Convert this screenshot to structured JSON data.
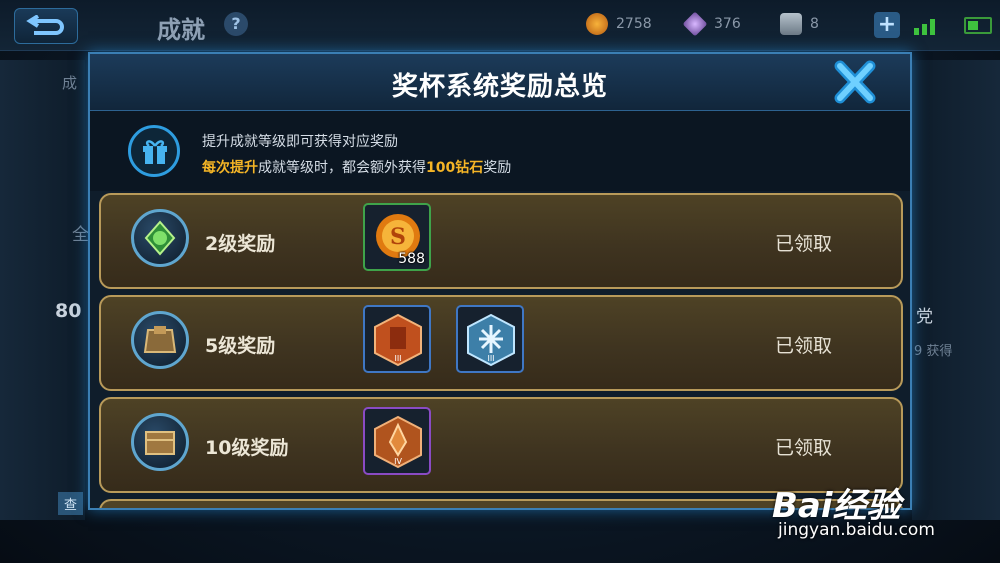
{
  "background": {
    "screen_title": "成就",
    "help_symbol": "?",
    "currencies": [
      {
        "icon": "gold-coin-icon",
        "value": "2758"
      },
      {
        "icon": "diamond-icon",
        "value": "376"
      },
      {
        "icon": "voucher-icon",
        "value": "8"
      }
    ],
    "plus_symbol": "+",
    "left_partial_texts": [
      "成",
      "全",
      "80"
    ],
    "right_partial_texts": [
      "党",
      "9 获得"
    ],
    "left_button_partial": "查"
  },
  "modal": {
    "title": "奖杯系统奖励总览",
    "info": {
      "line1": "提升成就等级即可获得对应奖励",
      "line2_pre": "每次提升",
      "line2_mid": "成就等级时，都会额外获得",
      "line2_amount": "100钻石",
      "line2_post": "奖励"
    },
    "rows": [
      {
        "label": "2级奖励",
        "status": "已领取",
        "icon": "green-gem-icon",
        "rewards": [
          {
            "name": "gold-coin-reward-icon",
            "count": "588",
            "border": "#3fa34a"
          }
        ]
      },
      {
        "label": "5级奖励",
        "status": "已领取",
        "icon": "armor-icon",
        "rewards": [
          {
            "name": "red-rune-reward-icon",
            "level": "III",
            "border": "#3f77c4"
          },
          {
            "name": "blue-rune-reward-icon",
            "level": "III",
            "border": "#3f77c4"
          }
        ]
      },
      {
        "label": "10级奖励",
        "status": "已领取",
        "icon": "treasure-chest-icon",
        "rewards": [
          {
            "name": "purple-rune-reward-icon",
            "level": "IV",
            "border": "#8a4bc4"
          }
        ]
      }
    ]
  },
  "watermark": {
    "brand": "Bai经验",
    "url": "jingyan.baidu.com"
  }
}
